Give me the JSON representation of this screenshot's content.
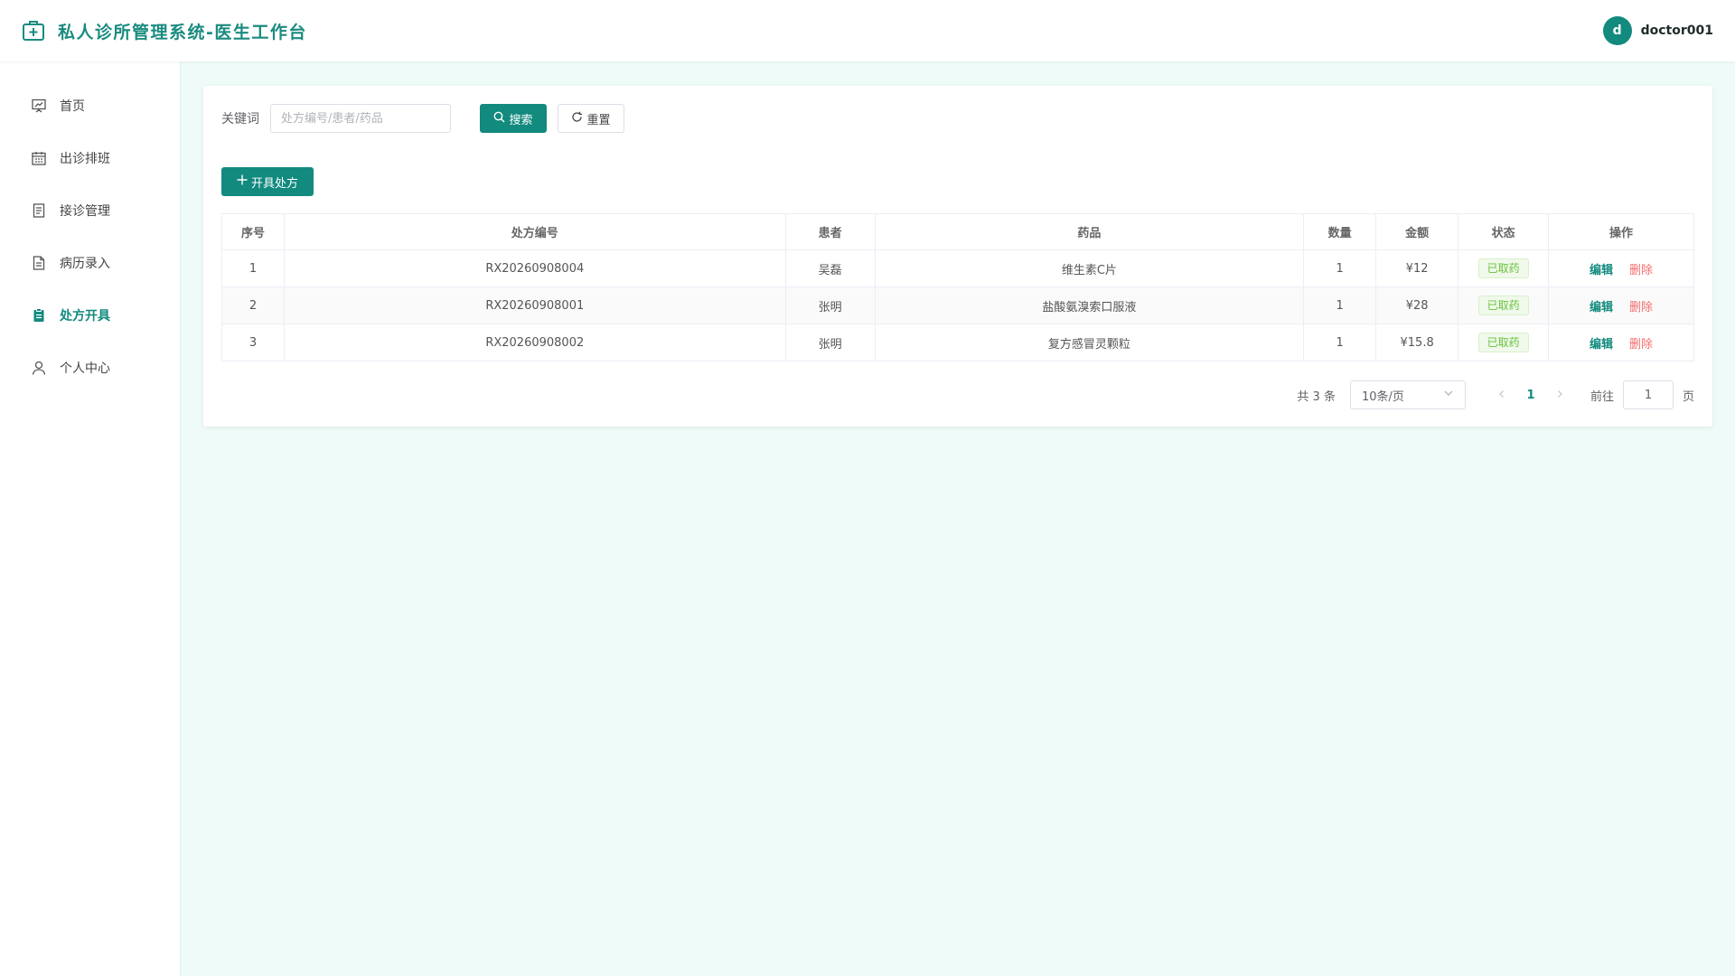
{
  "header": {
    "title": "私人诊所管理系统-医生工作台",
    "avatar_letter": "d",
    "username": "doctor001",
    "accent": "#128a7e"
  },
  "sidebar": {
    "items": [
      {
        "label": "首页",
        "icon": "presentation-chart-icon",
        "active": false
      },
      {
        "label": "出诊排班",
        "icon": "calendar-icon",
        "active": false
      },
      {
        "label": "接诊管理",
        "icon": "document-list-icon",
        "active": false
      },
      {
        "label": "病历录入",
        "icon": "document-icon",
        "active": false
      },
      {
        "label": "处方开具",
        "icon": "clipboard-icon",
        "active": true
      },
      {
        "label": "个人中心",
        "icon": "user-icon",
        "active": false
      }
    ]
  },
  "search": {
    "label": "关键词",
    "placeholder": "处方编号/患者/药品",
    "value": "",
    "search_button": "搜索",
    "reset_button": "重置"
  },
  "actions": {
    "add_button": "开具处方"
  },
  "table": {
    "columns": [
      "序号",
      "处方编号",
      "患者",
      "药品",
      "数量",
      "金额",
      "状态",
      "操作"
    ],
    "rows": [
      {
        "index": "1",
        "code": "RX20260908004",
        "patient": "吴磊",
        "drug": "维生素C片",
        "qty": "1",
        "amount": "¥12",
        "status": "已取药",
        "edit": "编辑",
        "delete": "删除"
      },
      {
        "index": "2",
        "code": "RX20260908001",
        "patient": "张明",
        "drug": "盐酸氨溴索口服液",
        "qty": "1",
        "amount": "¥28",
        "status": "已取药",
        "edit": "编辑",
        "delete": "删除"
      },
      {
        "index": "3",
        "code": "RX20260908002",
        "patient": "张明",
        "drug": "复方感冒灵颗粒",
        "qty": "1",
        "amount": "¥15.8",
        "status": "已取药",
        "edit": "编辑",
        "delete": "删除"
      }
    ]
  },
  "pagination": {
    "total_text": "共 3 条",
    "page_size": "10条/页",
    "current_page": "1",
    "jump_label": "前往",
    "jump_value": "1",
    "jump_suffix": "页"
  }
}
